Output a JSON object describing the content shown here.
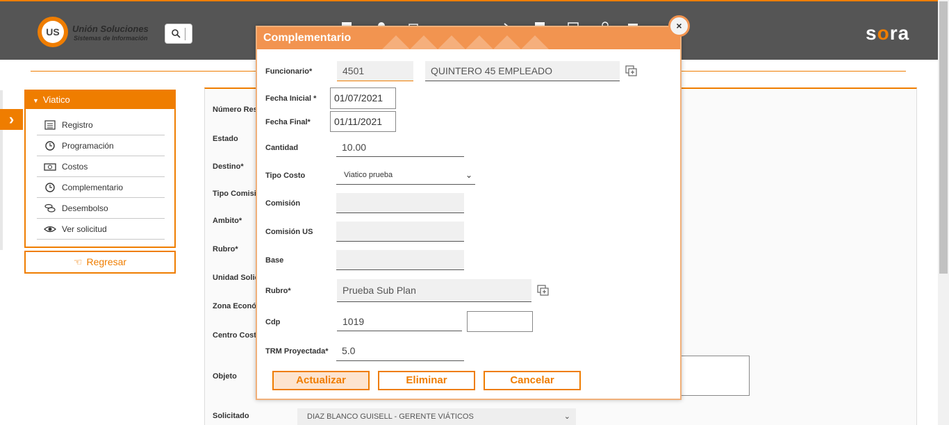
{
  "header": {
    "logo_mark": "US",
    "logo_name": "Unión Soluciones",
    "logo_sub": "Sistemas de Información",
    "brand_start": "s",
    "brand_o": "o",
    "brand_end": "ra"
  },
  "sidebar": {
    "title": "Viatico",
    "items": [
      {
        "label": "Registro",
        "icon": "list-icon"
      },
      {
        "label": "Programación",
        "icon": "clock-icon"
      },
      {
        "label": "Costos",
        "icon": "money-icon"
      },
      {
        "label": "Complementario",
        "icon": "clock-icon"
      },
      {
        "label": "Desembolso",
        "icon": "coins-icon"
      },
      {
        "label": "Ver solicitud",
        "icon": "eye-icon"
      }
    ],
    "back_label": "Regresar"
  },
  "background_form": {
    "labels": [
      "Número Res",
      "Estado",
      "Destino*",
      "Tipo Comisi",
      "Ambito*",
      "Rubro*",
      "Unidad Solic",
      "Zona Económ",
      "Centro Cost",
      "Objeto",
      "Solicitado"
    ],
    "solicitado_value": "DIAZ BLANCO GUISELL - GERENTE VIÁTICOS"
  },
  "modal": {
    "title": "Complementario",
    "close_symbol": "×",
    "funcionario_label": "Funcionario*",
    "funcionario_code": "4501",
    "funcionario_name": "QUINTERO 45 EMPLEADO",
    "fecha_inicial_label": "Fecha Inicial *",
    "fecha_inicial": "01/07/2021",
    "fecha_final_label": "Fecha Final*",
    "fecha_final": "01/11/2021",
    "cantidad_label": "Cantidad",
    "cantidad": "10.00",
    "tipo_costo_label": "Tipo Costo",
    "tipo_costo": "Viatico prueba",
    "comision_label": "Comisión",
    "comision": "",
    "comision_us_label": "Comisión US",
    "comision_us": "",
    "base_label": "Base",
    "base": "",
    "rubro_label": "Rubro*",
    "rubro": "Prueba Sub Plan",
    "cdp_label": "Cdp",
    "cdp": "1019",
    "cdp_extra": "",
    "trm_label": "TRM Proyectada*",
    "trm": "5.0",
    "buttons": {
      "update": "Actualizar",
      "delete": "Eliminar",
      "cancel": "Cancelar"
    }
  },
  "colors": {
    "accent": "#ef7d00",
    "topbar": "#555555",
    "modal_header": "#f29450"
  }
}
